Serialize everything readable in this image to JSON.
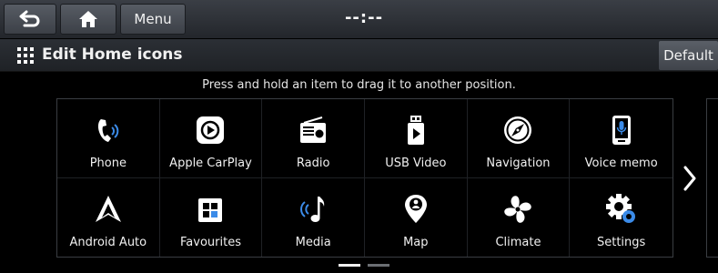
{
  "topbar": {
    "back_icon": "back-arrow-icon",
    "home_icon": "home-icon",
    "menu_label": "Menu",
    "clock": "--:--"
  },
  "titlebar": {
    "icon": "grid-icon",
    "title": "Edit Home icons",
    "default_label": "Default"
  },
  "instruction": "Press and hold an item to drag it to another position.",
  "icons": [
    {
      "label": "Phone",
      "icon": "phone-icon"
    },
    {
      "label": "Apple CarPlay",
      "icon": "apple-carplay-icon"
    },
    {
      "label": "Radio",
      "icon": "radio-icon"
    },
    {
      "label": "USB Video",
      "icon": "usb-video-icon"
    },
    {
      "label": "Navigation",
      "icon": "navigation-icon"
    },
    {
      "label": "Voice memo",
      "icon": "voice-memo-icon"
    },
    {
      "label": "Android Auto",
      "icon": "android-auto-icon"
    },
    {
      "label": "Favourites",
      "icon": "favourites-icon"
    },
    {
      "label": "Media",
      "icon": "media-icon"
    },
    {
      "label": "Map",
      "icon": "map-icon"
    },
    {
      "label": "Climate",
      "icon": "climate-icon"
    },
    {
      "label": "Settings",
      "icon": "settings-icon"
    }
  ],
  "pager": {
    "current": 1,
    "total": 2
  },
  "colors": {
    "accent_blue": "#3b8be8",
    "background": "#000000"
  }
}
